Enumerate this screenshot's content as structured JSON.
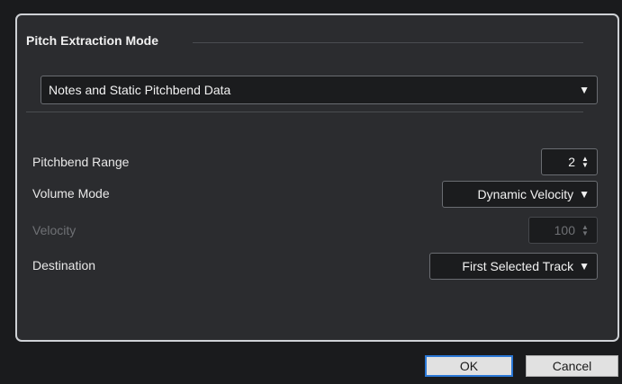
{
  "section": {
    "title": "Pitch Extraction Mode",
    "mode_value": "Notes and Static Pitchbend Data"
  },
  "rows": {
    "pitchbend_range": {
      "label": "Pitchbend Range",
      "value": "2"
    },
    "volume_mode": {
      "label": "Volume Mode",
      "value": "Dynamic Velocity"
    },
    "velocity": {
      "label": "Velocity",
      "value": "100"
    },
    "destination": {
      "label": "Destination",
      "value": "First Selected Track"
    }
  },
  "icons": {
    "dropdown_arrow": "▼",
    "spin_up": "▲",
    "spin_down": "▼"
  },
  "buttons": {
    "ok": "OK",
    "cancel": "Cancel"
  },
  "colors": {
    "background": "#1a1b1d",
    "panel": "#2b2c2f",
    "panel_border": "#cfd2d6",
    "field": "#1b1c1e",
    "ok_focus": "#2b78d6"
  }
}
